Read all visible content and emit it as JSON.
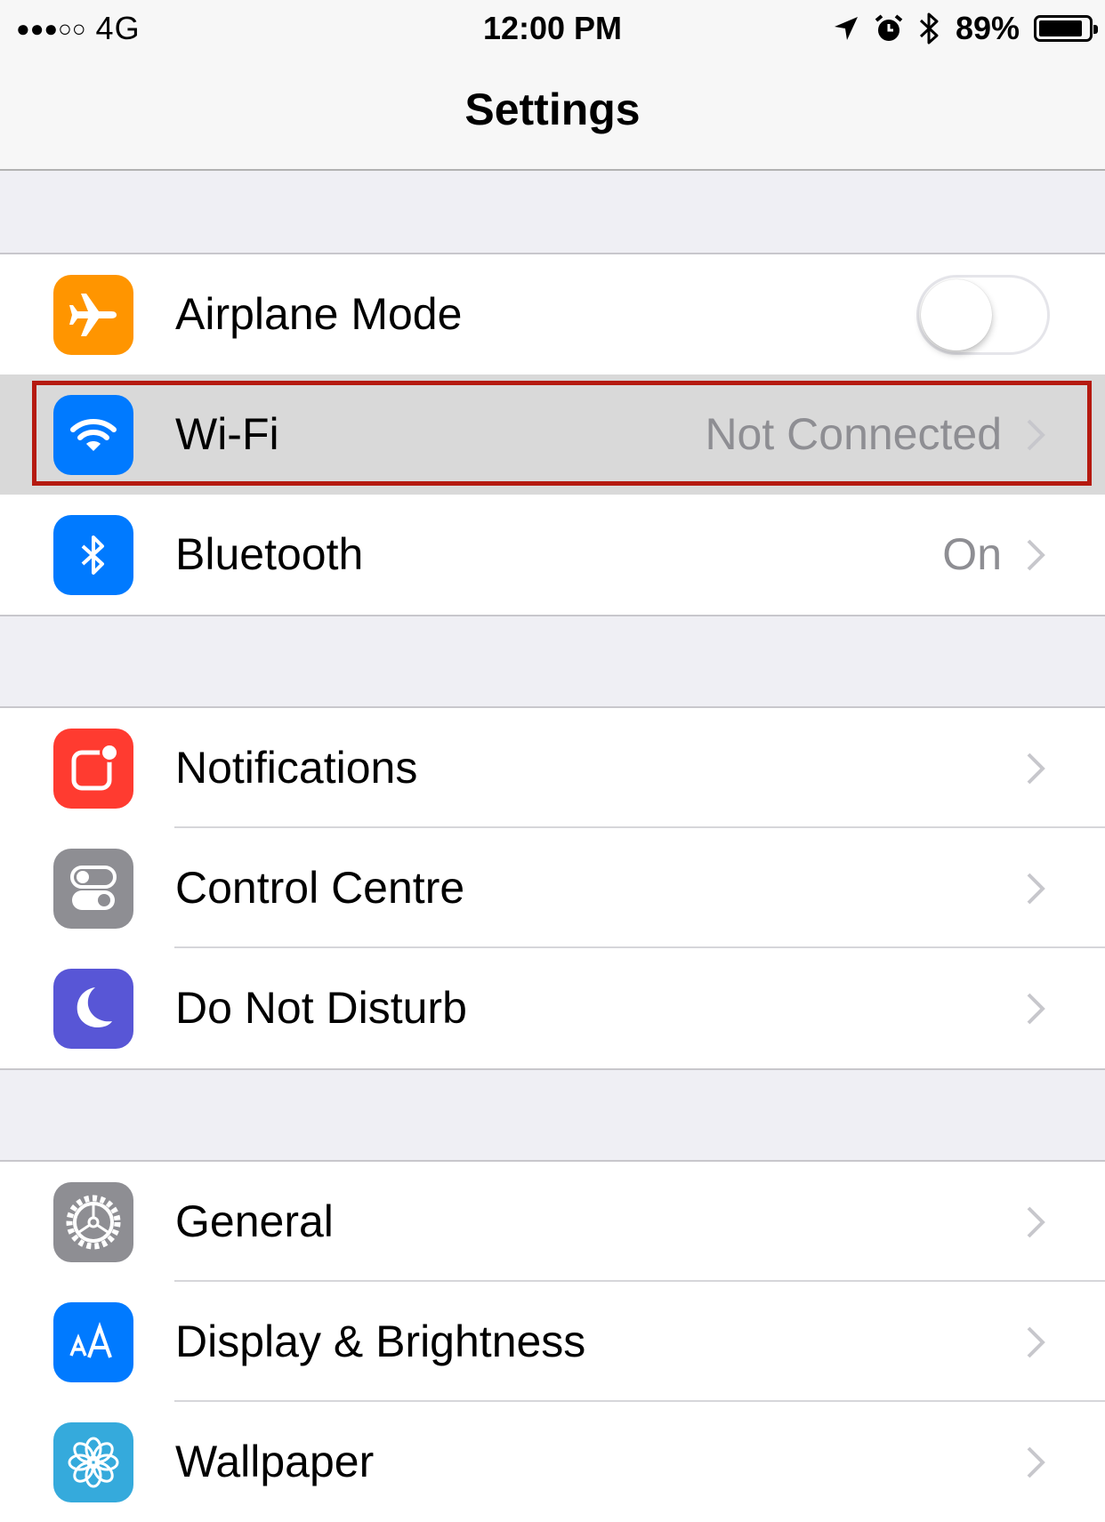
{
  "status_bar": {
    "signal_dots": "●●●○○",
    "network": "4G",
    "time": "12:00 PM",
    "battery_percent": "89%",
    "battery_level": 0.89,
    "icons": [
      "location-arrow-icon",
      "alarm-clock-icon",
      "bluetooth-icon",
      "battery-icon"
    ]
  },
  "nav": {
    "title": "Settings"
  },
  "groups": [
    {
      "rows": [
        {
          "label": "Airplane Mode",
          "icon": "airplane-icon",
          "icon_bg": "#ff9500",
          "control": "toggle",
          "toggle_on": false
        },
        {
          "label": "Wi-Fi",
          "icon": "wifi-icon",
          "icon_bg": "#007aff",
          "detail": "Not Connected",
          "highlighted": true
        },
        {
          "label": "Bluetooth",
          "icon": "bluetooth-icon",
          "icon_bg": "#007aff",
          "detail": "On"
        }
      ]
    },
    {
      "rows": [
        {
          "label": "Notifications",
          "icon": "notifications-icon",
          "icon_bg": "#ff3b30"
        },
        {
          "label": "Control Centre",
          "icon": "control-centre-icon",
          "icon_bg": "#8e8e93"
        },
        {
          "label": "Do Not Disturb",
          "icon": "moon-icon",
          "icon_bg": "#5856d6"
        }
      ]
    },
    {
      "rows": [
        {
          "label": "General",
          "icon": "gear-icon",
          "icon_bg": "#8e8e93"
        },
        {
          "label": "Display & Brightness",
          "icon": "text-size-icon",
          "icon_bg": "#007aff"
        },
        {
          "label": "Wallpaper",
          "icon": "flower-icon",
          "icon_bg": "#35aadc"
        }
      ]
    }
  ],
  "colors": {
    "highlight_frame": "#b51a10",
    "detail_text": "#8e8e93",
    "group_background": "#efeff4"
  }
}
